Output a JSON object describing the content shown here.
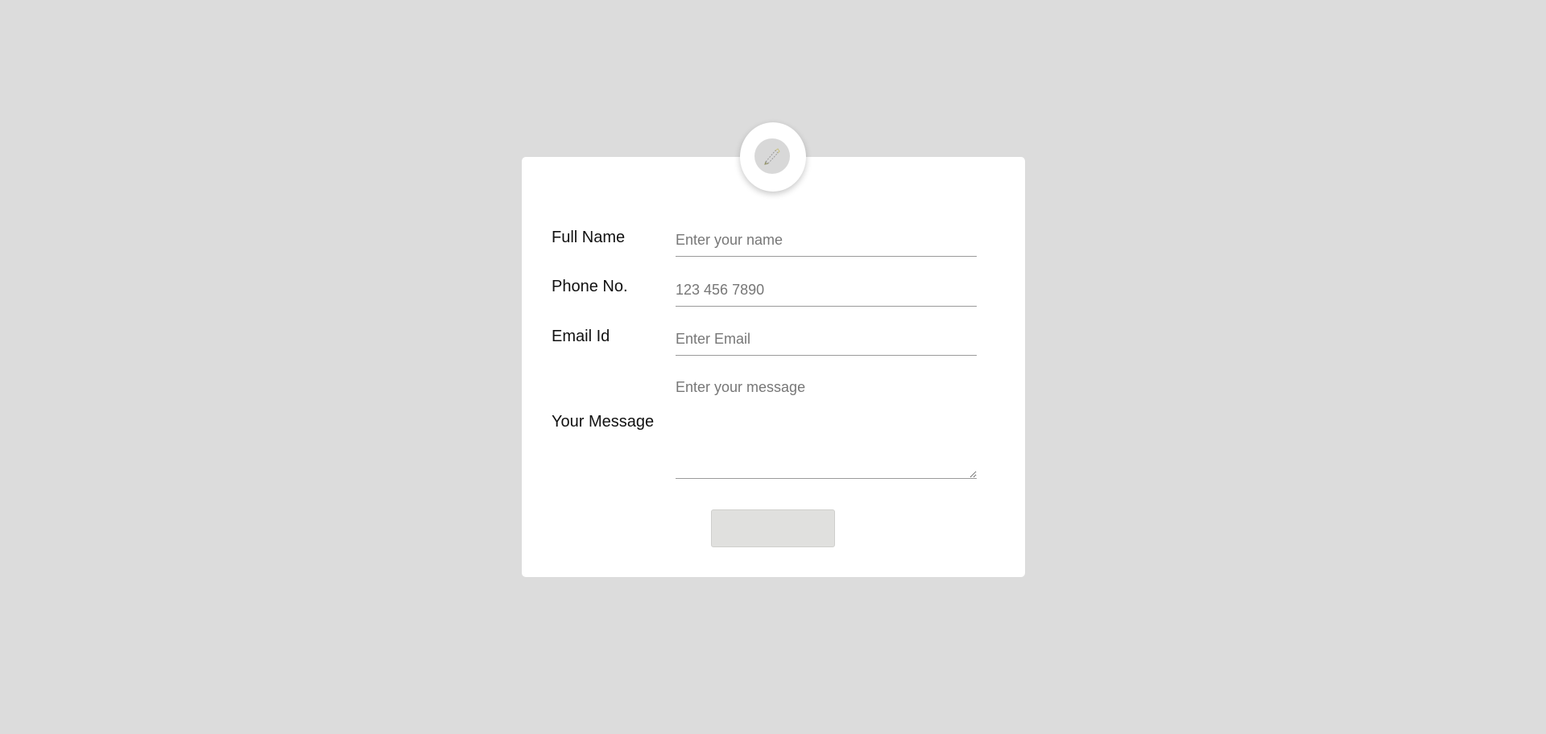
{
  "form": {
    "fields": [
      {
        "label": "Full Name",
        "placeholder": "Enter your name"
      },
      {
        "label": "Phone No.",
        "placeholder": "123 456 7890"
      },
      {
        "label": "Email Id",
        "placeholder": "Enter Email"
      },
      {
        "label": "Your Message",
        "placeholder": "Enter your message"
      }
    ],
    "submit_label": ""
  },
  "logo": {
    "icon": "pen-icon"
  },
  "colors": {
    "background": "#dcdcdc",
    "card": "#ffffff",
    "button": "#e0e0de",
    "underline": "#9a9a9a"
  }
}
